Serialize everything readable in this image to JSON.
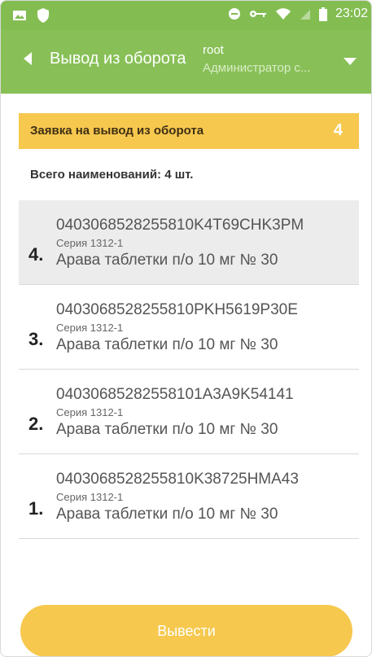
{
  "status_bar": {
    "time": "23:02",
    "icons": [
      "image-icon",
      "shield-icon",
      "dnd-icon",
      "key-icon",
      "wifi-icon",
      "no-sim-icon",
      "battery-icon"
    ]
  },
  "app_bar": {
    "title": "Вывод из оборота",
    "user": "root",
    "role": "Администратор с..."
  },
  "request": {
    "label": "Заявка на вывод из оборота",
    "count": "4"
  },
  "summary": "Всего наименований: 4 шт.",
  "items": [
    {
      "number": "4.",
      "code": "0403068528255810K4T69CHK3PM",
      "series": "Серия 1312-1",
      "product": "Арава таблетки п/о 10 мг № 30",
      "selected": true
    },
    {
      "number": "3.",
      "code": "0403068528255810PKH5619P30E",
      "series": "Серия 1312-1",
      "product": "Арава таблетки п/о 10 мг № 30"
    },
    {
      "number": "2.",
      "code": "04030685282558101A3A9K54141",
      "series": "Серия 1312-1",
      "product": "Арава таблетки п/о 10 мг № 30"
    },
    {
      "number": "1.",
      "code": "0403068528255810K38725HMA43",
      "series": "Серия 1312-1",
      "product": "Арава таблетки п/о 10 мг № 30"
    }
  ],
  "action": {
    "label": "Вывести"
  },
  "colors": {
    "accent": "#88c057",
    "yellow": "#f6c84e",
    "selected": "#ececec"
  }
}
